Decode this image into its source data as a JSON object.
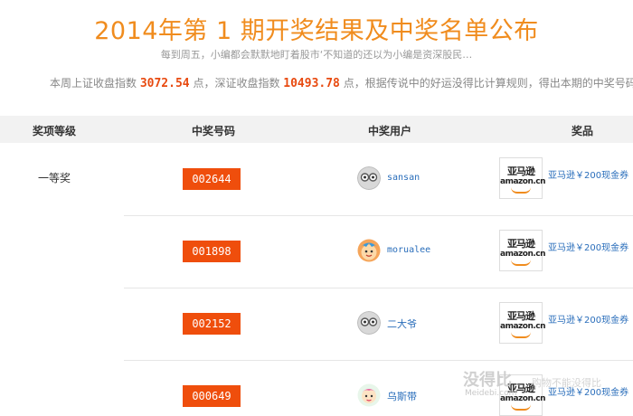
{
  "header": {
    "title": "2014年第 1 期开奖结果及中奖名单公布",
    "subtitle": "每到周五，小编都会默默地盯着股市‘不知道的还以为小编是资深股民…",
    "info_before": "本周上证收盘指数 ",
    "sh_index": "3072.54",
    "info_mid": " 点，深证收盘指数 ",
    "sz_index": "10493.78",
    "info_after": " 点，根据传说中的好运没得比计算规则，得出本期的中奖号码为："
  },
  "table": {
    "headers": [
      "奖项等级",
      "中奖号码",
      "中奖用户",
      "奖品"
    ],
    "level": "一等奖",
    "rows": [
      {
        "code": "002644",
        "user": "sansan",
        "prize_logo_cn": "亚马逊",
        "prize_logo_en": "amazon.cn",
        "prize": "亚马逊￥200现金券"
      },
      {
        "code": "001898",
        "user": "morualee",
        "prize_logo_cn": "亚马逊",
        "prize_logo_en": "amazon.cn",
        "prize": "亚马逊￥200现金券"
      },
      {
        "code": "002152",
        "user": "二大爷",
        "prize_logo_cn": "亚马逊",
        "prize_logo_en": "amazon.cn",
        "prize": "亚马逊￥200现金券"
      },
      {
        "code": "000649",
        "user": "乌斯带",
        "prize_logo_cn": "亚马逊",
        "prize_logo_en": "amazon.cn",
        "prize": "亚马逊￥200现金券"
      }
    ]
  },
  "watermark": {
    "brand": "没得比",
    "tagline": "购物不能没得比",
    "domain": "Meidebi.com"
  },
  "colors": {
    "title": "#f08c1e",
    "code_bg": "#ef4e0c",
    "link": "#2a6ebb",
    "header_bg": "#f2f2f2"
  }
}
